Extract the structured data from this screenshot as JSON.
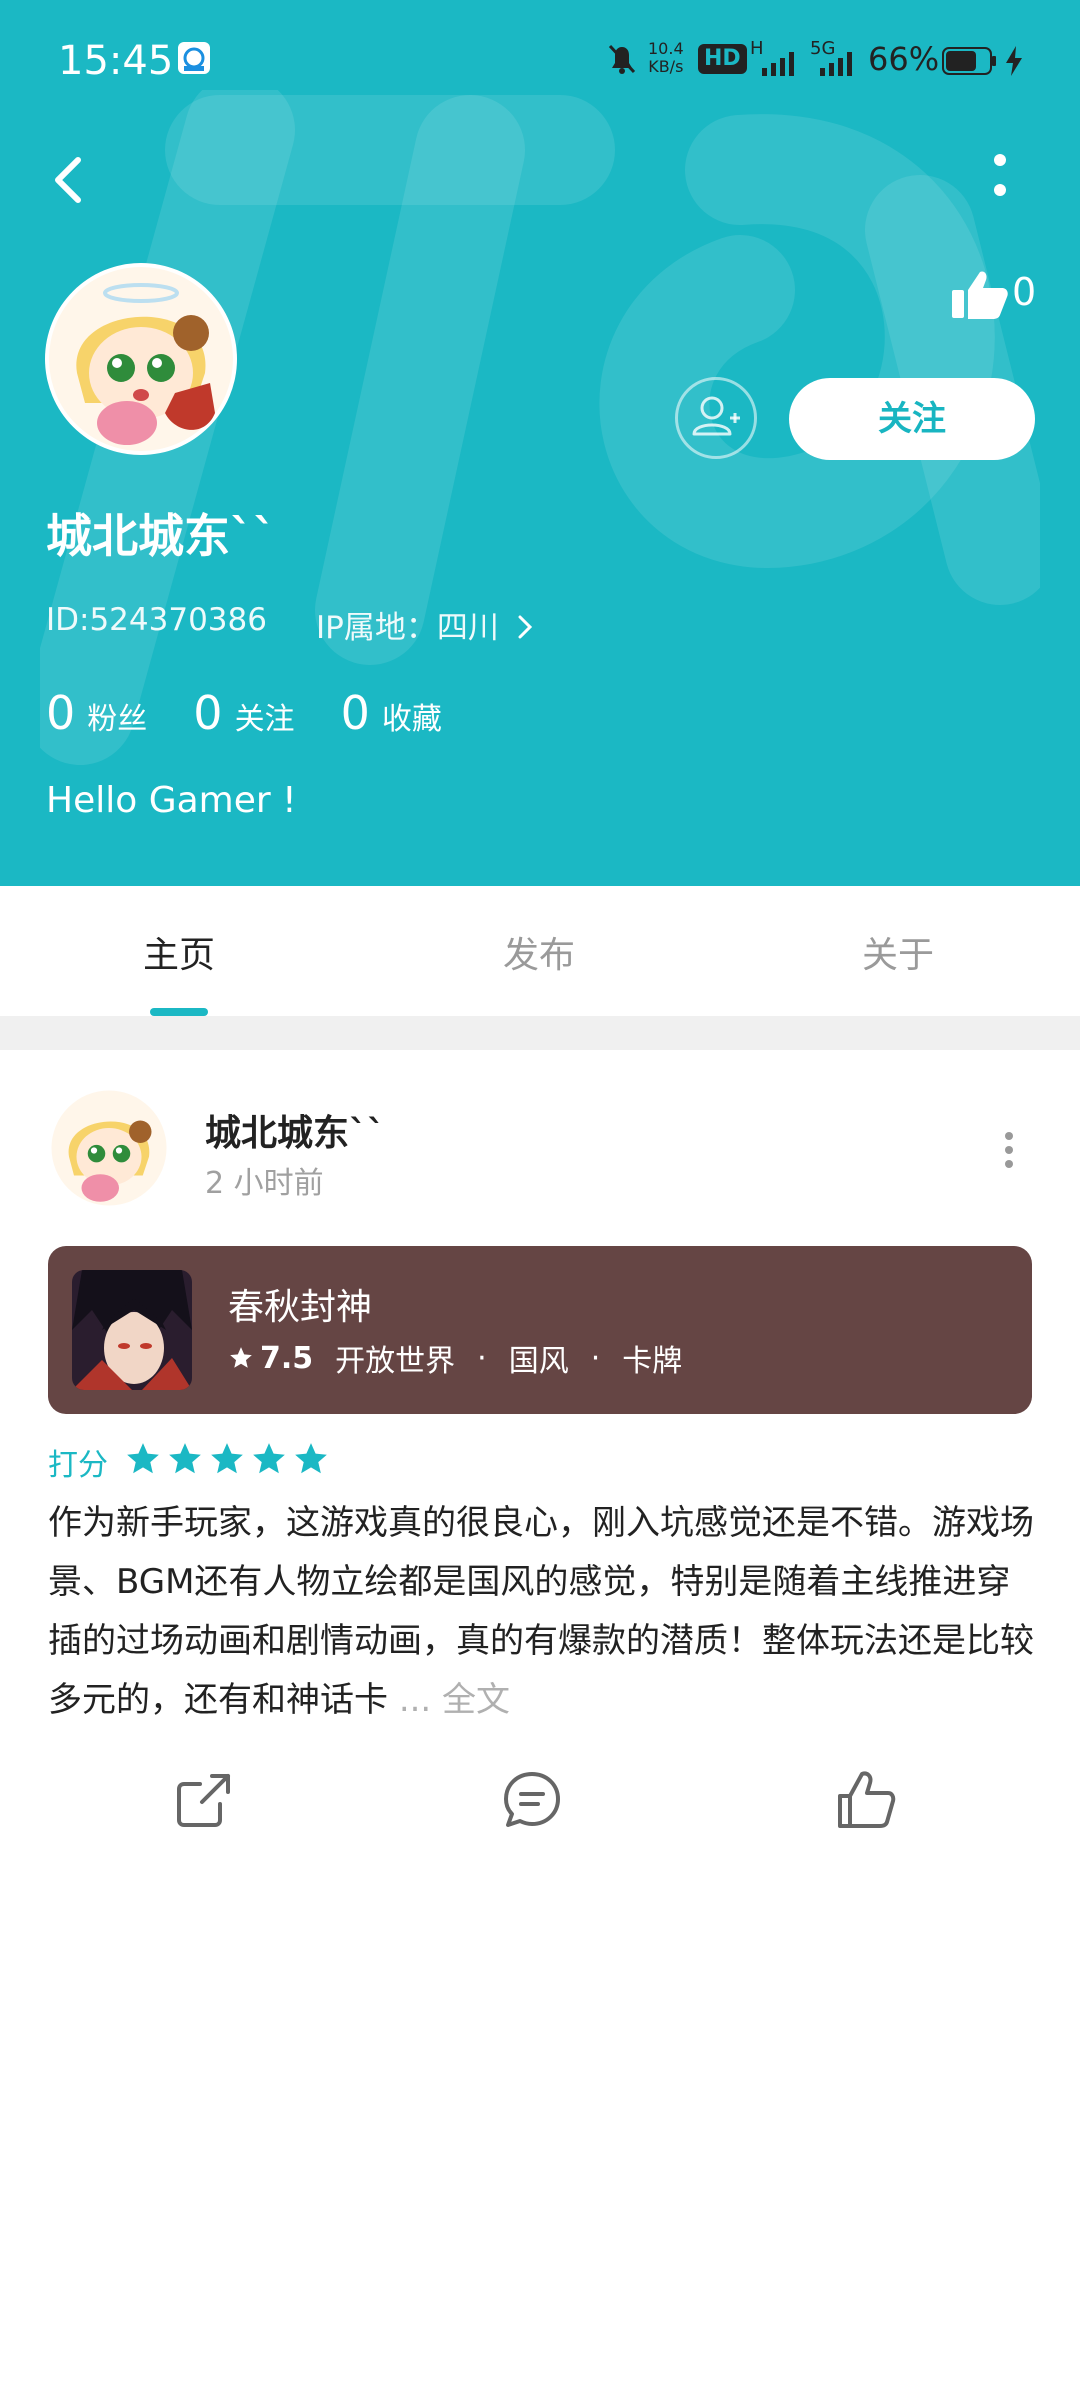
{
  "status_bar": {
    "time": "15:45",
    "net_speed": "10.4",
    "net_unit": "KB/s",
    "hd_badge": "HD",
    "signal_1": "H",
    "signal_2": "5G",
    "battery": "66%",
    "icons": [
      "app-notification-icon",
      "bell-mute-icon",
      "hd-icon",
      "signal-icon",
      "5g-signal-icon",
      "battery-icon",
      "charging-icon"
    ]
  },
  "header": {
    "like_count": "0",
    "follow_label": "关注",
    "username": "城北城东``",
    "id_text": "ID:524370386",
    "ip_text": "IP属地：四川",
    "stats": [
      {
        "num": "0",
        "label": "粉丝"
      },
      {
        "num": "0",
        "label": "关注"
      },
      {
        "num": "0",
        "label": "收藏"
      }
    ],
    "bio": "Hello Gamer !"
  },
  "tabs": [
    {
      "label": "主页",
      "active": true
    },
    {
      "label": "发布",
      "active": false
    },
    {
      "label": "关于",
      "active": false
    }
  ],
  "post": {
    "author": "城北城东``",
    "time": "2 小时前",
    "game": {
      "title": "春秋封神",
      "score": "7.5",
      "tags": [
        "开放世界",
        "国风",
        "卡牌"
      ],
      "card_color": "#654544"
    },
    "rating_label": "打分",
    "stars": 5,
    "text": "作为新手玩家，这游戏真的很良心，刚入坑感觉还是不错。游戏场景、BGM还有人物立绘都是国风的感觉，特别是随着主线推进穿插的过场动画和剧情动画，真的有爆款的潜质！整体玩法还是比较多元的，还有和神话卡",
    "more": "... 全文"
  },
  "colors": {
    "accent": "#1bb8c4",
    "header_bg": "#1bb8c4"
  }
}
